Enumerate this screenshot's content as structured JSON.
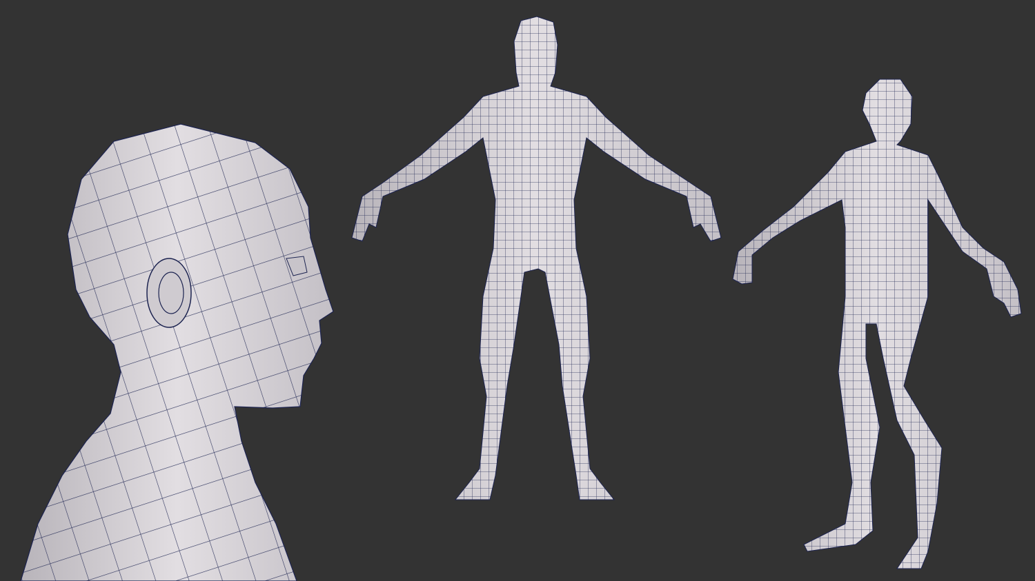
{
  "scene": {
    "background_color": "#333333",
    "mesh_fill_color": "#dcd8dc",
    "mesh_shade_color": "#bdb9bf",
    "wire_color": "#1c2350",
    "views": [
      {
        "name": "head-closeup-side-view"
      },
      {
        "name": "body-front-view"
      },
      {
        "name": "body-three-quarter-view"
      }
    ]
  }
}
